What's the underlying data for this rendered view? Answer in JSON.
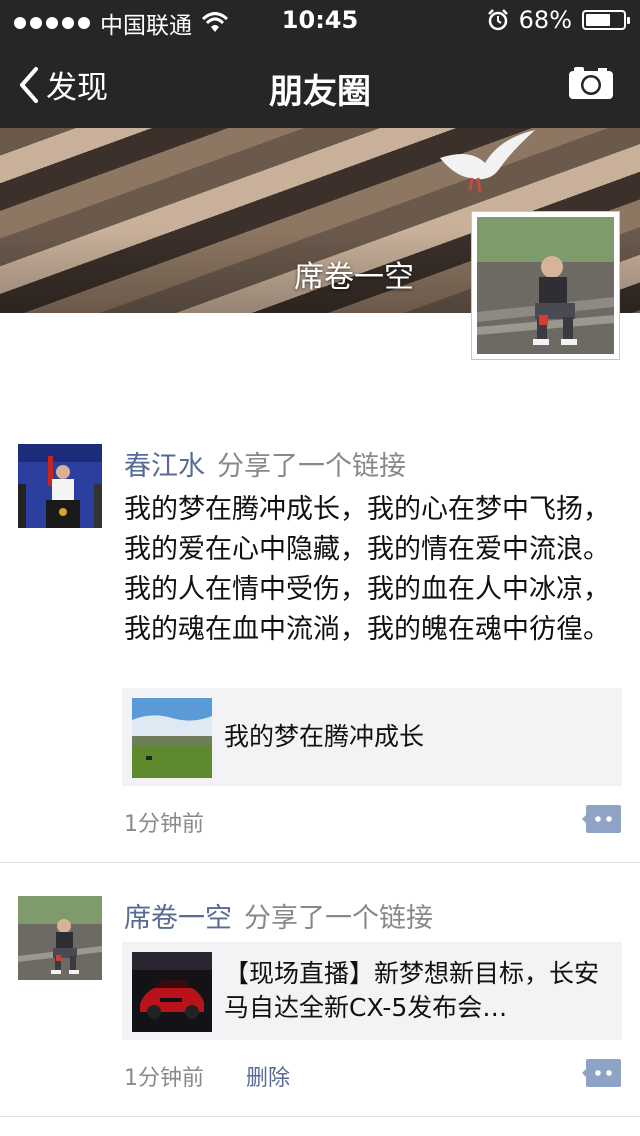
{
  "status_bar": {
    "carrier": "中国联通",
    "time": "10:45",
    "battery": "68%",
    "battery_level": 0.68
  },
  "nav": {
    "back_label": "发现",
    "title": "朋友圈",
    "camera_icon": "camera-icon"
  },
  "cover": {
    "user_name": "席卷一空"
  },
  "posts": [
    {
      "author": "春江水",
      "action": "分享了一个链接",
      "text": "我的梦在腾冲成长，我的心在梦中飞扬，我的爱在心中隐藏，我的情在爱中流浪。我的人在情中受伤，我的血在人中冰凉，我的魂在血中流淌，我的魄在魂中彷徨。",
      "link_title": "我的梦在腾冲成长",
      "time": "1分钟前"
    },
    {
      "author": "席卷一空",
      "action": "分享了一个链接",
      "link_title": "【现场直播】新梦想新目标，长安马自达全新CX-5发布会…",
      "time": "1分钟前",
      "delete_label": "删除"
    }
  ],
  "colors": {
    "nav_bg": "#262628",
    "link_blue": "#576b95",
    "meta_gray": "#8a8a8a"
  }
}
